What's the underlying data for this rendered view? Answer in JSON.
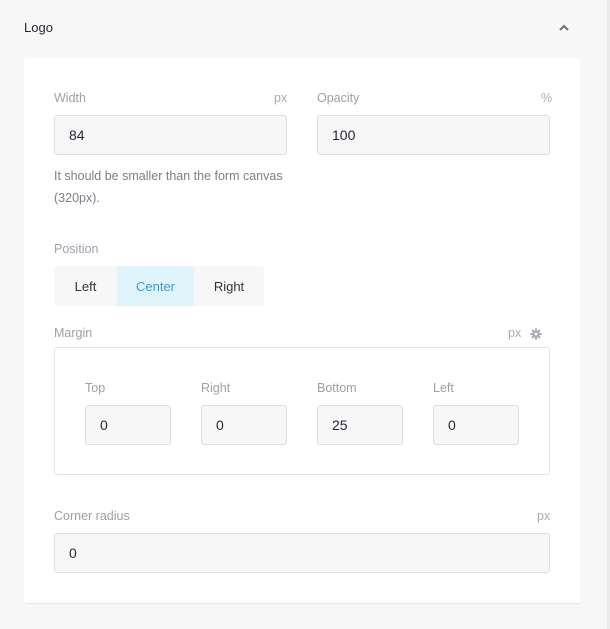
{
  "section": {
    "title": "Logo",
    "collapse_icon": "chevron-up-icon"
  },
  "width": {
    "label": "Width",
    "unit": "px",
    "value": "84",
    "help": "It should be smaller than the form canvas (320px)."
  },
  "opacity": {
    "label": "Opacity",
    "unit": "%",
    "value": "100"
  },
  "position": {
    "label": "Position",
    "options": [
      "Left",
      "Center",
      "Right"
    ],
    "selected": "Center",
    "active_color": "#3a9ad9"
  },
  "margin": {
    "label": "Margin",
    "unit": "px",
    "settings_icon": "gear-icon",
    "fields": [
      {
        "label": "Top",
        "value": "0"
      },
      {
        "label": "Right",
        "value": "0"
      },
      {
        "label": "Bottom",
        "value": "25"
      },
      {
        "label": "Left",
        "value": "0"
      }
    ]
  },
  "corner_radius": {
    "label": "Corner radius",
    "unit": "px",
    "value": "0"
  }
}
